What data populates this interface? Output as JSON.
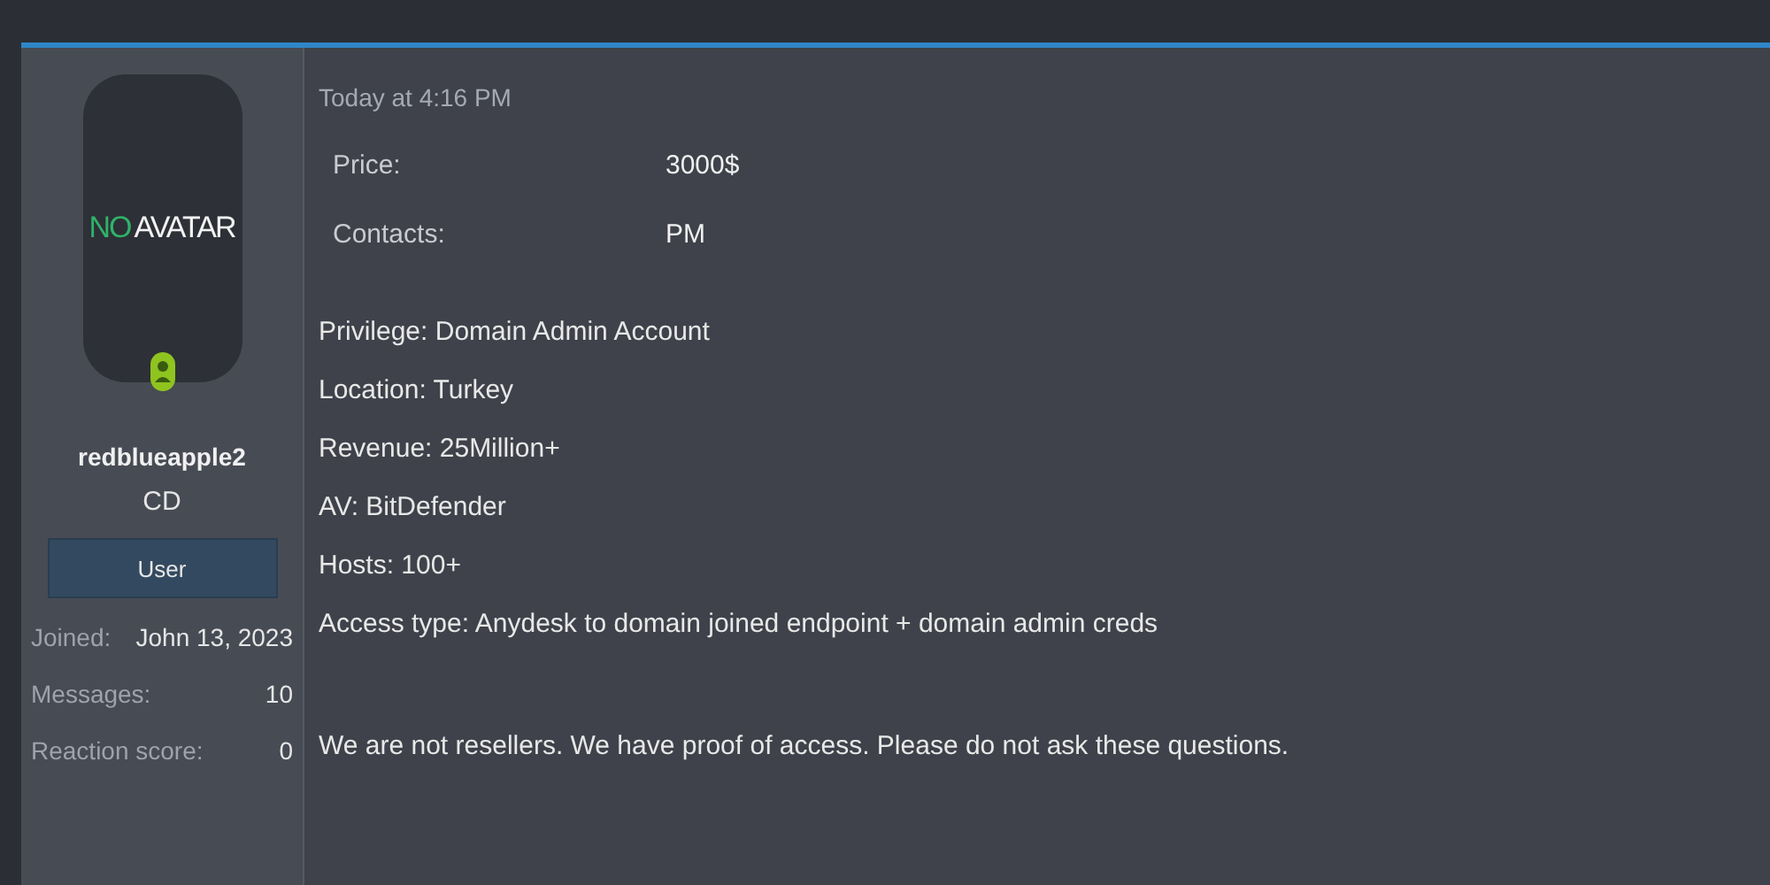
{
  "author": {
    "avatar_text": [
      {
        "text": "NO",
        "color": "#2fb36b"
      },
      {
        "text": "AVATAR",
        "color": "#f2f2f2"
      }
    ],
    "online": true,
    "username": "redblueapple2",
    "title": "CD",
    "role": "User",
    "stats": [
      {
        "label": "Joined:",
        "value": "John 13, 2023"
      },
      {
        "label": "Messages:",
        "value": "10"
      },
      {
        "label": "Reaction score:",
        "value": "0"
      }
    ]
  },
  "post": {
    "time": "Today at 4:16 PM",
    "fields": [
      {
        "label": "Price:",
        "value": "3000$"
      },
      {
        "label": "Contacts:",
        "value": "PM"
      }
    ],
    "lines": [
      "Privilege: Domain Admin Account",
      "Location: Turkey",
      "Revenue: 25Million+",
      "AV: BitDefender",
      "Hosts: 100+",
      "Access type: Anydesk to domain joined endpoint + domain admin creds"
    ],
    "note": "We are not resellers. We have proof of access. Please do not ask these questions."
  }
}
